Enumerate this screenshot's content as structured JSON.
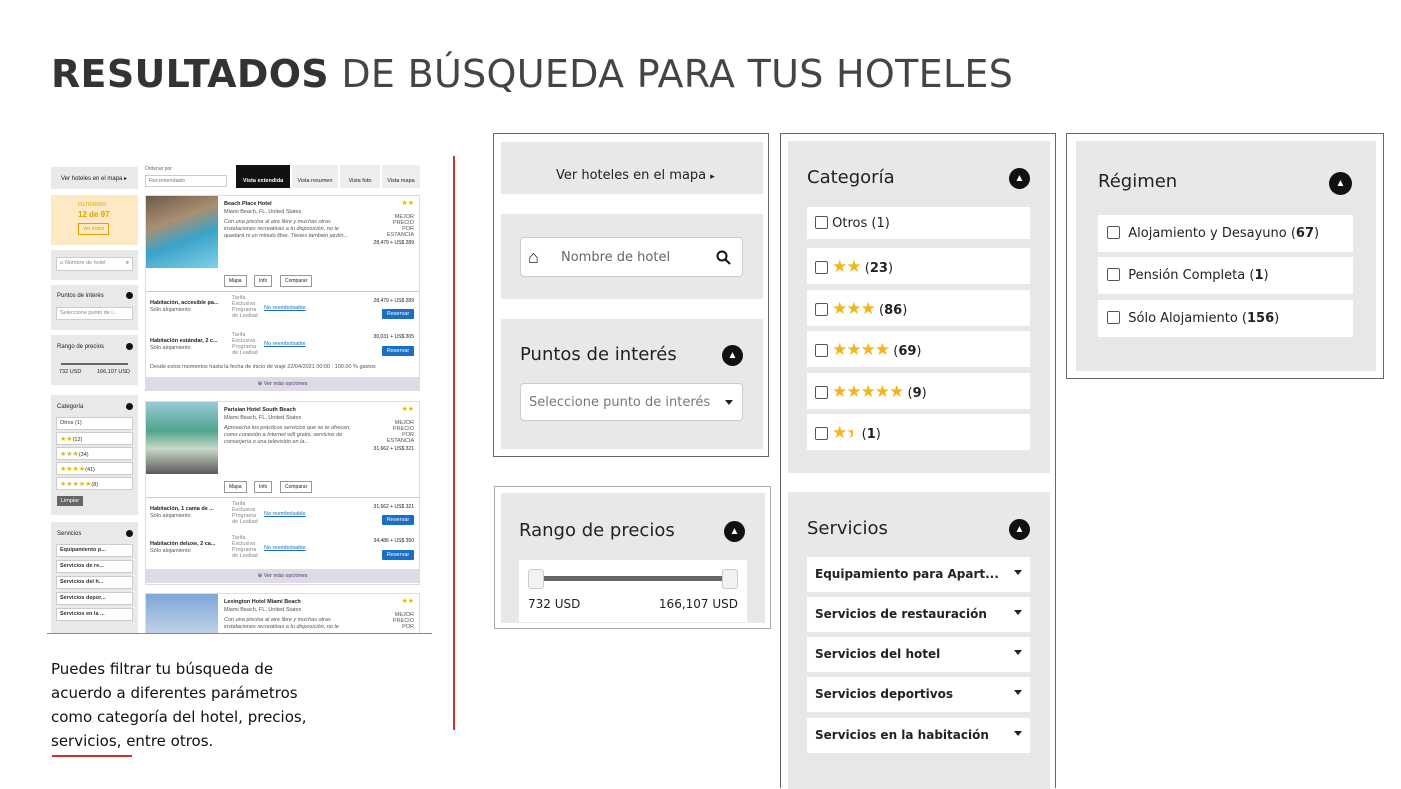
{
  "heading": {
    "bold": "RESULTADOS",
    "light": " DE BÚSQUEDA PARA TUS HOTELES"
  },
  "description": "Puedes filtrar tu búsqueda de acuerdo a diferentes parámetros como categoría del hotel, precios, servicios, entre otros.",
  "mini": {
    "map_link": "Ver hoteles en el mapa ▸",
    "sort_label": "Ordenar por",
    "sort_value": "Recomendado",
    "views": [
      "Vista extendida",
      "Vista resumen",
      "Vista foto",
      "Vista mapa"
    ],
    "filtered_label": "FILTRANDO:",
    "filtered_count": "12 de 97",
    "see_all": "Ver todos",
    "hotel_search_placeholder": "Nombre de hotel",
    "poi_title": "Puntos de interés",
    "poi_placeholder": "Seleccione punto de i...",
    "price_title": "Rango de precios",
    "price_min": "732 USD",
    "price_max": "166,107 USD",
    "category_title": "Categoría",
    "categories": [
      "Otros (1)",
      "(12)",
      "(34)",
      "(41)",
      "(8)"
    ],
    "clear": "Limpiar",
    "services_title": "Servicios",
    "services": [
      "Equipamiento p...",
      "Servicios de re...",
      "Servicios del h...",
      "Servicios depor...",
      "Servicios en la ..."
    ],
    "hotels": [
      {
        "name": "Beach Place Hotel",
        "location": "Miami Beach, FL, United States",
        "desc": "Con una piscina al aire libre y muchas otras instalaciones recreativas a tu disposición, no te quedará ni un minuto libre. Tienes también jardín...",
        "best": "MEJOR PRECIO POR ESTANCIA",
        "price": "28,479 + US$ 289",
        "rooms": [
          {
            "name": "Habitación, accesible pa...",
            "board": "Sólo alojamiento",
            "price": "28,479 + US$ 289"
          },
          {
            "name": "Habitación estándar, 2 c...",
            "board": "Sólo alojamiento",
            "price": "30,031 + US$ 305"
          }
        ],
        "note": "Desde estos momentos hasta la fecha de inicio de viaje 22/04/2021 00:00 : 100.00 % gastos"
      },
      {
        "name": "Parisian Hotel South Beach",
        "location": "Miami Beach, FL, United States",
        "desc": "Aprovecha los prácticos servicios que se te ofrecen, como conexión a Internet wifi gratis, servicios de conserjería o una televisión en la...",
        "best": "MEJOR PRECIO POR ESTANCIA",
        "price": "31,662 + US$ 321",
        "rooms": [
          {
            "name": "Habitación, 1 cama de ...",
            "board": "Sólo alojamiento",
            "price": "31,662 + US$ 321"
          },
          {
            "name": "Habitación deluxe, 2 ca...",
            "board": "Sólo alojamiento",
            "price": "34,486 + US$ 350"
          }
        ]
      },
      {
        "name": "Lexington Hotel Miami Beach",
        "location": "Miami Beach, FL, United States",
        "desc": "Con una piscina al aire libre y muchas otras instalaciones recreativas a tu disposición, no te",
        "best": "MEJOR PRECIO POR"
      }
    ],
    "buttons": {
      "map": "Mapa",
      "info": "Info",
      "compare": "Comparar",
      "reserve": "Reservar",
      "more": "⊕ Ver más opciones",
      "tariff": "Tarifa Exclusiva Programa de Lealtad",
      "nonref": "No reembolsable"
    }
  },
  "panel1": {
    "map_link": "Ver hoteles en el mapa",
    "search_placeholder": "Nombre de hotel",
    "poi_title": "Puntos de interés",
    "poi_placeholder": "Seleccione punto de interés"
  },
  "price_panel": {
    "title": "Rango de precios",
    "min": "732 USD",
    "max": "166,107 USD",
    "range_fraction": [
      0,
      1
    ]
  },
  "category_panel": {
    "title": "Categoría",
    "items": [
      {
        "label": "Otros",
        "count": "1",
        "stars": 0
      },
      {
        "label": "",
        "count": "23",
        "stars": 2
      },
      {
        "label": "",
        "count": "86",
        "stars": 3
      },
      {
        "label": "",
        "count": "69",
        "stars": 4
      },
      {
        "label": "",
        "count": "9",
        "stars": 5
      },
      {
        "label": "",
        "count": "1",
        "stars": 1.5
      }
    ]
  },
  "services_panel": {
    "title": "Servicios",
    "items": [
      "Equipamiento para Apart...",
      "Servicios de restauración",
      "Servicios del hotel",
      "Servicios deportivos",
      "Servicios en la habitación"
    ]
  },
  "regime_panel": {
    "title": "Régimen",
    "items": [
      {
        "label": "Alojamiento y Desayuno",
        "count": "67"
      },
      {
        "label": "Pensión Completa",
        "count": "1"
      },
      {
        "label": "Sólo Alojamiento",
        "count": "156"
      }
    ]
  }
}
